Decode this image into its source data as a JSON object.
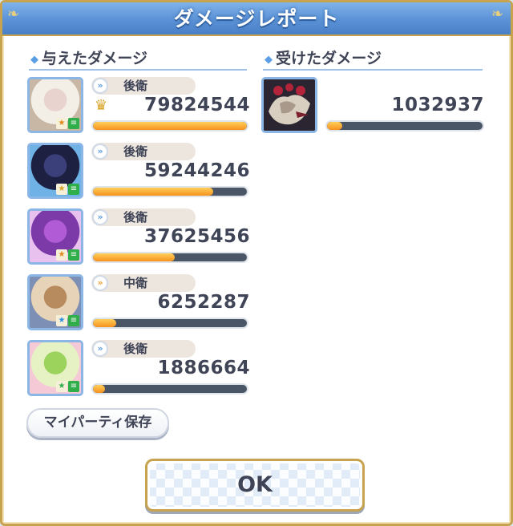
{
  "window": {
    "title": "ダメージレポート"
  },
  "dealt": {
    "title": "与えたダメージ",
    "rows": [
      {
        "position": "後衛",
        "damage": "79824544",
        "bar": 1.0,
        "crown": true,
        "palette": [
          "#f3eee6",
          "#e9d3cf",
          "#c9b7a5"
        ],
        "badge": "orange"
      },
      {
        "position": "後衛",
        "damage": "59244246",
        "bar": 0.78,
        "crown": false,
        "palette": [
          "#1e2042",
          "#3b3f7a",
          "#6fb2e6"
        ],
        "badge": "yellow"
      },
      {
        "position": "後衛",
        "damage": "37625456",
        "bar": 0.53,
        "crown": false,
        "palette": [
          "#7c3aa8",
          "#b25bd6",
          "#e9c1ef"
        ],
        "badge": "orange"
      },
      {
        "position": "中衛",
        "damage": "6252287",
        "bar": 0.15,
        "crown": false,
        "palette": [
          "#e7d3b7",
          "#b78b5e",
          "#7d8fb4"
        ],
        "badge": "blue"
      },
      {
        "position": "後衛",
        "damage": "1886664",
        "bar": 0.08,
        "crown": false,
        "palette": [
          "#e6f2c3",
          "#9bd35c",
          "#f5c9d6"
        ],
        "badge": "green"
      }
    ]
  },
  "received": {
    "title": "受けたダメージ",
    "rows": [
      {
        "damage": "1032937",
        "bar": 0.1
      }
    ]
  },
  "buttons": {
    "save_label": "マイパーティ保存",
    "ok_label": "OK"
  },
  "icons": {
    "position_back": "double-chevron-icon",
    "position_mid": "double-chevron-icon",
    "crown": "crown-icon"
  },
  "colors": {
    "header": "#5b92d6",
    "frame_gold": "#c7a24f",
    "bar_fill": "#f6921e",
    "bar_empty": "#4a5566"
  }
}
